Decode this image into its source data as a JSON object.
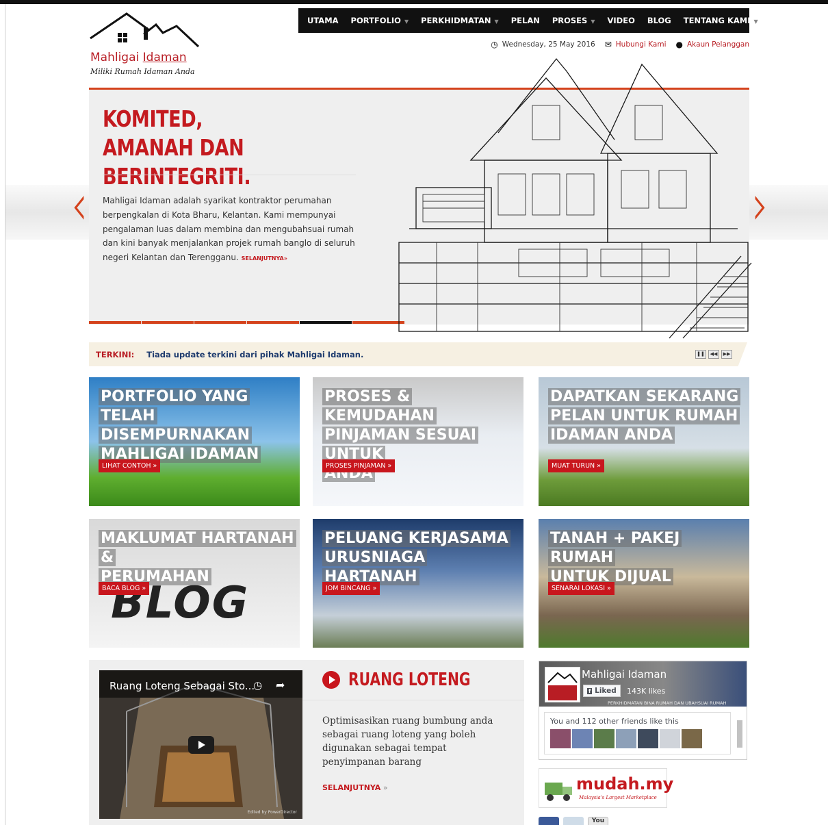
{
  "brand": {
    "name_part1": "Mahligai ",
    "name_part2": "Idaman",
    "tagline": "Miliki Rumah Idaman Anda"
  },
  "nav": {
    "items": [
      {
        "label": "UTAMA",
        "dropdown": false
      },
      {
        "label": "PORTFOLIO",
        "dropdown": true
      },
      {
        "label": "PERKHIDMATAN",
        "dropdown": true
      },
      {
        "label": "PELAN",
        "dropdown": false
      },
      {
        "label": "PROSES",
        "dropdown": true
      },
      {
        "label": "VIDEO",
        "dropdown": false
      },
      {
        "label": "BLOG",
        "dropdown": false
      },
      {
        "label": "TENTANG KAMI",
        "dropdown": true
      }
    ]
  },
  "infobar": {
    "date": "Wednesday, 25 May 2016",
    "contact": "Hubungi Kami",
    "account": "Akaun Pelanggan"
  },
  "hero": {
    "title": "KOMITED, AMANAH DAN BERINTEGRITI.",
    "text": "Mahligai Idaman adalah syarikat kontraktor perumahan berpengkalan di Kota Bharu, Kelantan. Kami mempunyai pengalaman luas dalam membina dan mengubahsuai rumah dan kini banyak menjalankan projek rumah banglo di seluruh negeri Kelantan dan Terengganu. ",
    "more": "SELANJUTNYA»",
    "slides": 6,
    "active_slide": 5
  },
  "ticker": {
    "label": "TERKINI:",
    "text": "Tiada update terkini dari pihak Mahligai Idaman."
  },
  "tiles": [
    {
      "title": [
        "PORTFOLIO YANG TELAH",
        "DISEMPURNAKAN",
        "MAHLIGAI IDAMAN"
      ],
      "button": "LIHAT CONTOH »"
    },
    {
      "title": [
        "PROSES & KEMUDAHAN",
        "PINJAMAN SESUAI UNTUK",
        "ANDA"
      ],
      "button": "PROSES PINJAMAN »"
    },
    {
      "title": [
        "DAPATKAN SEKARANG",
        "PELAN UNTUK RUMAH",
        "IDAMAN ANDA"
      ],
      "button": "MUAT TURUN »"
    },
    {
      "title": [
        "MAKLUMAT HARTANAH &",
        "PERUMAHAN"
      ],
      "button": "BACA BLOG »",
      "graphic": "BLOG"
    },
    {
      "title": [
        "PELUANG KERJASAMA",
        "URUSNIAGA HARTANAH"
      ],
      "button": "JOM BINCANG »"
    },
    {
      "title": [
        "TANAH + PAKEJ RUMAH",
        "UNTUK DIJUAL"
      ],
      "button": "SENARAI LOKASI »"
    }
  ],
  "video_section": {
    "video_title": "Ruang Loteng Sebagai Sto...",
    "credit": "Edited by PowerDirector",
    "heading": "RUANG LOTENG",
    "text": "Optimisasikan ruang bumbung anda sebagai ruang loteng yang boleh digunakan sebagai tempat penyimpanan barang",
    "more": "SELANJUTNYA",
    "more_suffix": " »"
  },
  "facebook": {
    "page_name": "Mahligai Idaman",
    "like_label": "Liked",
    "likes": "143K likes",
    "subtitle": "PERKHIDMATAN BINA RUMAH DAN UBAHSUAI RUMAH",
    "friends": "You and 112 other friends like this"
  },
  "mudah": {
    "name": "mudah.my",
    "tagline": "Malaysia's Largest Marketplace"
  },
  "social": {
    "youtube": "You"
  },
  "colors": {
    "brand_red": "#c41a1f",
    "accent_orange": "#d4421c",
    "nav_bg": "#111111",
    "ticker_bg": "#f6f0e2"
  }
}
